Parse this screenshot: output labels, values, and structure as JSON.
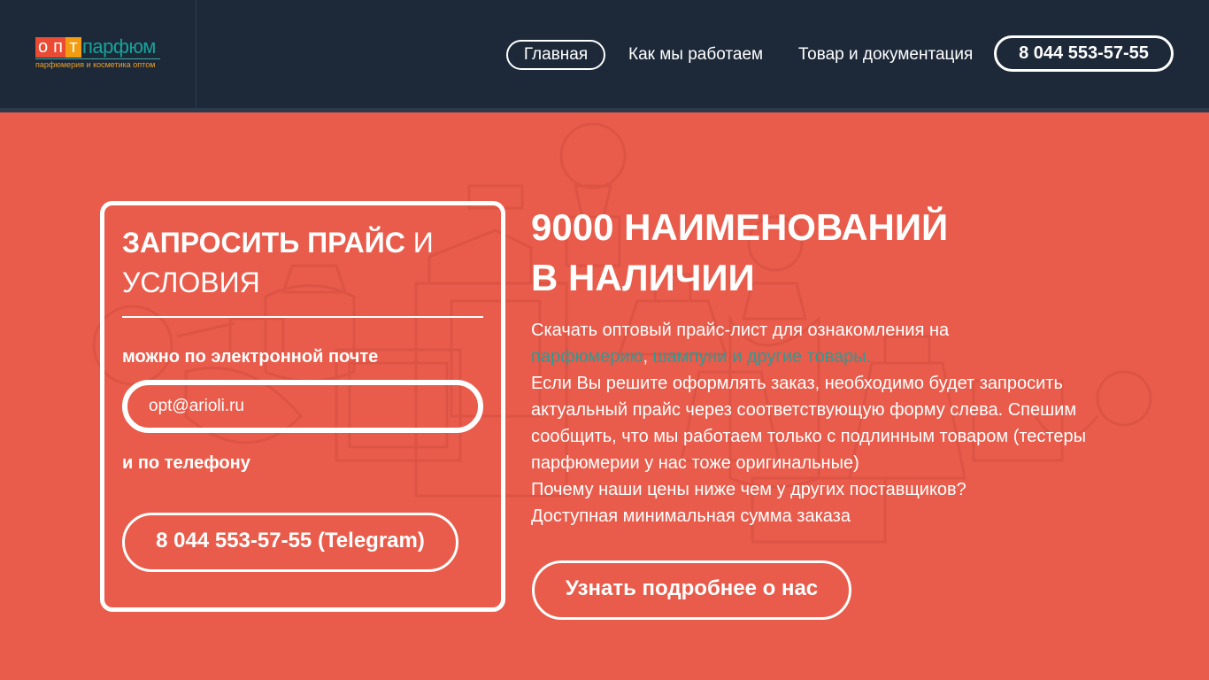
{
  "logo": {
    "letters": [
      "о",
      "п",
      "т"
    ],
    "letter_colors": [
      "#e94b35",
      "#e94b35",
      "#f39c12"
    ],
    "word": "парфюм",
    "tagline": "парфюмерия и косметика оптом"
  },
  "nav": {
    "items": [
      "Главная",
      "Как мы работаем",
      "Товар и документация"
    ],
    "phone": "8 044 553-57-55"
  },
  "request_card": {
    "title_bold": "ЗАПРОСИТЬ ПРАЙС",
    "title_rest": " И УСЛОВИЯ",
    "email_label": "можно по электронной почте",
    "email_value": "opt@arioli.ru",
    "phone_label": "и по телефону",
    "phone_button": "8 044 553-57-55 (Telegram)"
  },
  "main": {
    "headline_line1": "9000 НАИМЕНОВАНИЙ",
    "headline_line2": "В НАЛИЧИИ",
    "intro": "Скачать оптовый прайс-лист для ознакомления на",
    "link_perfume": "парфюмерию",
    "comma": ",",
    "link_shampoo": "шампуни и другие товары.",
    "paragraph": "Если Вы решите оформлять заказ, необходимо будет запросить актуальный прайс через соответствующую форму слева. Спешим сообщить, что мы работаем только с подлинным товаром (тестеры парфюмерии у нас тоже оригинальные)",
    "line_why": "Почему наши цены ниже чем у других поставщиков?",
    "line_min": "Доступная минимальная сумма заказа",
    "more_button": "Узнать подробнее о нас"
  },
  "colors": {
    "header_bg": "#1d2939",
    "page_bg": "#e95c4b",
    "link": "#2d9a94"
  }
}
